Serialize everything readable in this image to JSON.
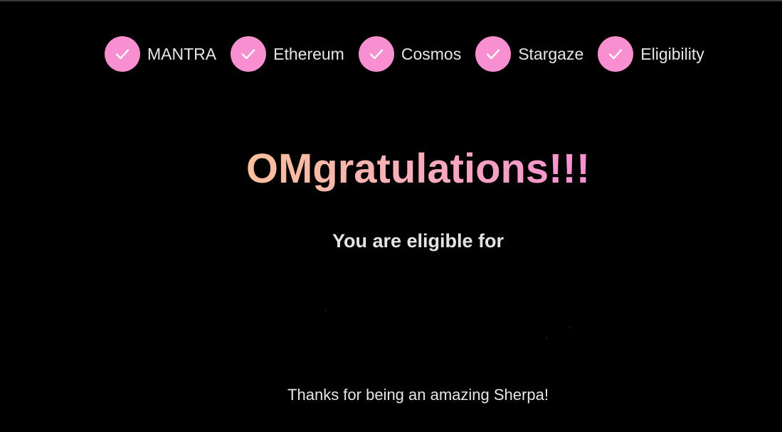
{
  "stepper": {
    "steps": [
      {
        "label": "MANTRA",
        "status": "completed",
        "icon": "checkmark-icon"
      },
      {
        "label": "Ethereum",
        "status": "completed",
        "icon": "checkmark-icon"
      },
      {
        "label": "Cosmos",
        "status": "completed",
        "icon": "checkmark-icon"
      },
      {
        "label": "Stargaze",
        "status": "completed",
        "icon": "checkmark-icon"
      },
      {
        "label": "Eligibility",
        "status": "completed",
        "icon": "checkmark-icon"
      }
    ],
    "accent_color": "#f78fd0"
  },
  "main": {
    "headline": "OMgratulations!!!",
    "eligible_text": "You are eligible for",
    "thanks_text": "Thanks for being an amazing Sherpa!"
  },
  "colors": {
    "background": "#000000",
    "gradient_start": "#f8c09a",
    "gradient_end": "#f78fd0",
    "text": "#e6e6e6"
  }
}
